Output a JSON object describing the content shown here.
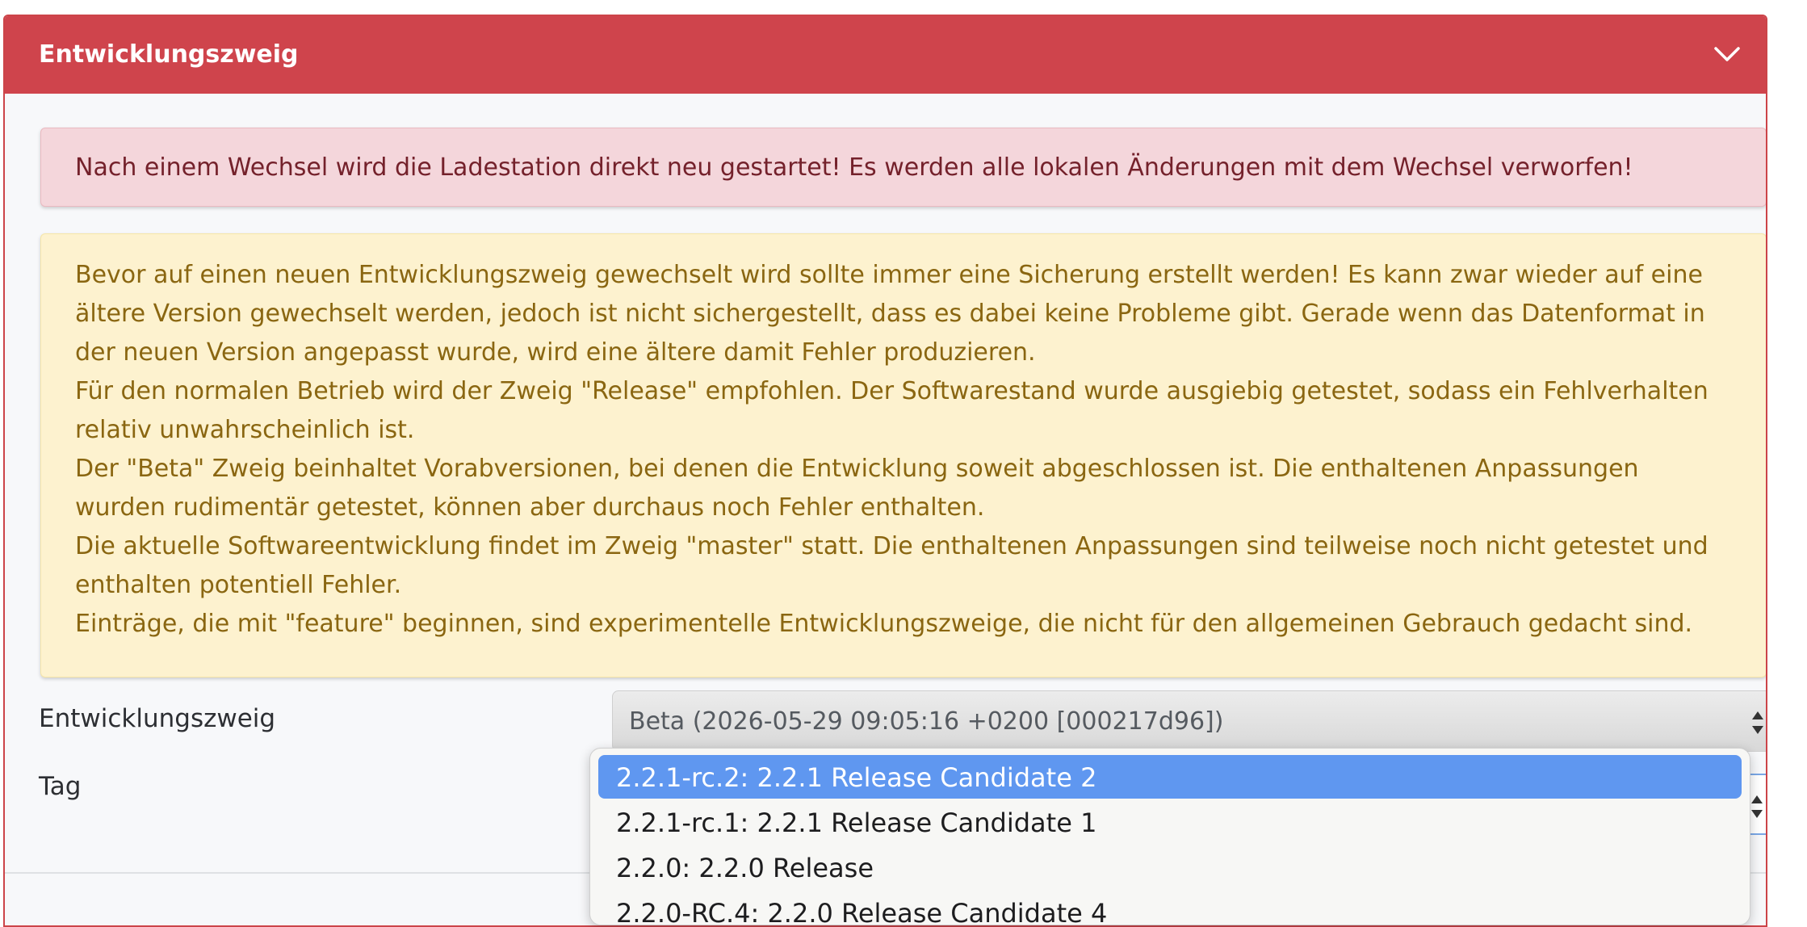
{
  "card": {
    "title": "Entwicklungszweig",
    "collapse_icon": "chevron-down-icon"
  },
  "alert_danger": {
    "text": "Nach einem Wechsel wird die Ladestation direkt neu gestartet! Es werden alle lokalen Änderungen mit dem Wechsel verworfen!"
  },
  "alert_warning": {
    "paragraphs": [
      "Bevor auf einen neuen Entwicklungszweig gewechselt wird sollte immer eine Sicherung erstellt werden! Es kann zwar wieder auf eine ältere Version gewechselt werden, jedoch ist nicht sichergestellt, dass es dabei keine Probleme gibt. Gerade wenn das Datenformat in der neuen Version angepasst wurde, wird eine ältere damit Fehler produzieren.",
      "Für den normalen Betrieb wird der Zweig \"Release\" empfohlen. Der Softwarestand wurde ausgiebig getestet, sodass ein Fehlverhalten relativ unwahrscheinlich ist.",
      "Der \"Beta\" Zweig beinhaltet Vorabversionen, bei denen die Entwicklung soweit abgeschlossen ist. Die enthaltenen Anpassungen wurden rudimentär getestet, können aber durchaus noch Fehler enthalten.",
      "Die aktuelle Softwareentwicklung findet im Zweig \"master\" statt. Die enthaltenen Anpassungen sind teilweise noch nicht getestet und enthalten potentiell Fehler.",
      "Einträge, die mit \"feature\" beginnen, sind experimentelle Entwicklungszweige, die nicht für den allgemeinen Gebrauch gedacht sind."
    ]
  },
  "form": {
    "branch_label": "Entwicklungszweig",
    "branch_value": "Beta (2026-05-29 09:05:16 +0200 [000217d96])",
    "tag_label": "Tag"
  },
  "tag_dropdown": {
    "options": [
      "2.2.1-rc.2: 2.2.1 Release Candidate 2",
      "2.2.1-rc.1: 2.2.1 Release Candidate 1",
      "2.2.0: 2.2.0 Release",
      "2.2.0-RC.4: 2.2.0 Release Candidate 4"
    ],
    "selected_index": 0
  },
  "colors": {
    "header": "#cf444c",
    "danger_bg": "#f4d6db",
    "warning_bg": "#fdf2cf",
    "selected_option": "#5f97f0"
  }
}
